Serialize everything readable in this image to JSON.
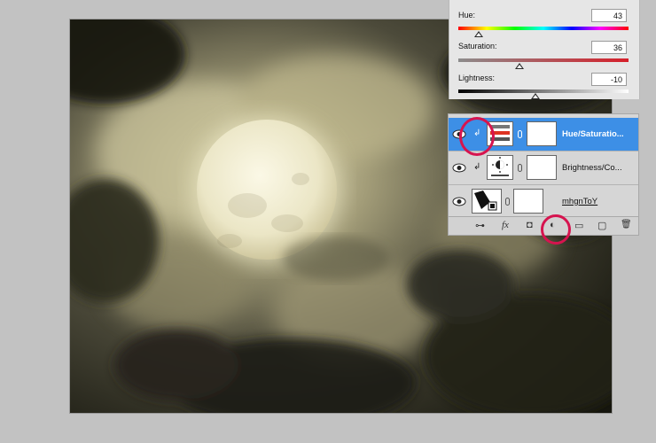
{
  "hue_sat_panel": {
    "hue": {
      "label": "Hue:",
      "value": "43",
      "level": 0.12
    },
    "saturation": {
      "label": "Saturation:",
      "value": "36",
      "level": 0.36
    },
    "lightness": {
      "label": "Lightness:",
      "value": "-10",
      "level": 0.45
    }
  },
  "layers": {
    "items": [
      {
        "name": "Hue/Saturatio...",
        "selected": true,
        "clipped": true
      },
      {
        "name": "Brightness/Co...",
        "selected": false,
        "clipped": true
      },
      {
        "name": "mhgnToY",
        "selected": false,
        "clipped": false
      }
    ],
    "bottom_bar": {
      "link": "⊶",
      "fx": "fx",
      "mask": "◘",
      "adjustment": "◐",
      "group": "▭",
      "new": "▢",
      "delete": "🗑"
    }
  },
  "colors": {
    "selection": "#3d8fe6",
    "highlight_ring": "#d6144f"
  }
}
